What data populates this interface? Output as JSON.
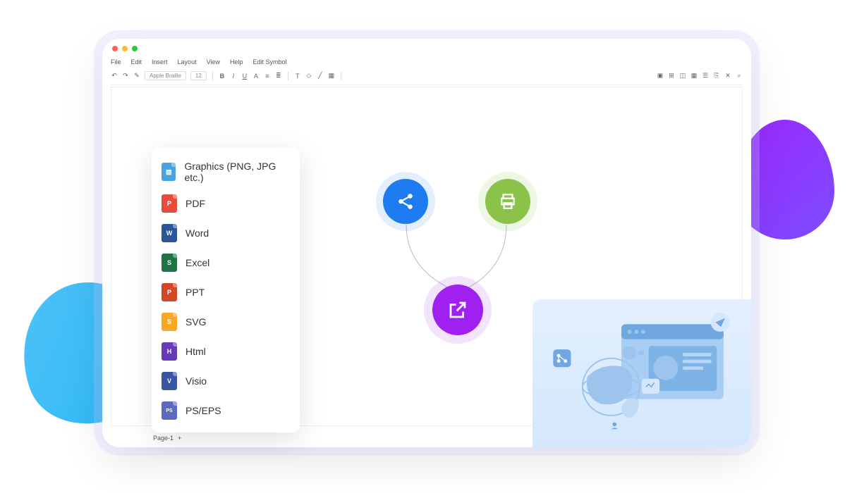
{
  "window": {
    "menu": [
      "File",
      "Edit",
      "Insert",
      "Layout",
      "View",
      "Help",
      "Edit Symbol"
    ],
    "font_name": "Apple Braille",
    "font_size": "12"
  },
  "page_tab": "Page-1",
  "export_menu": [
    {
      "label": "Graphics (PNG, JPG etc.)",
      "icon_class": "fi-blue",
      "icon_char": "▧"
    },
    {
      "label": "PDF",
      "icon_class": "fi-red",
      "icon_char": "P"
    },
    {
      "label": "Word",
      "icon_class": "fi-darkblue",
      "icon_char": "W"
    },
    {
      "label": "Excel",
      "icon_class": "fi-green",
      "icon_char": "S"
    },
    {
      "label": "PPT",
      "icon_class": "fi-orange",
      "icon_char": "P"
    },
    {
      "label": "SVG",
      "icon_class": "fi-yellow",
      "icon_char": "S"
    },
    {
      "label": "Html",
      "icon_class": "fi-purple",
      "icon_char": "H"
    },
    {
      "label": "Visio",
      "icon_class": "fi-visioblue",
      "icon_char": "V"
    },
    {
      "label": "PS/EPS",
      "icon_class": "fi-indigo",
      "icon_char": "PS"
    }
  ]
}
